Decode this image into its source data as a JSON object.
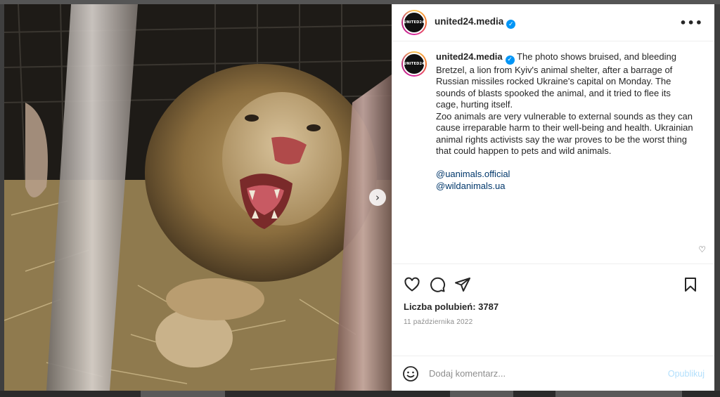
{
  "post": {
    "username": "united24.media",
    "verified_mark": "✓",
    "avatar_text": "UNITED24",
    "more_label": "•••",
    "caption": {
      "username": "united24.media",
      "paragraph_1": "The photo shows bruised, and bleeding Bretzel, a lion from Kyiv's animal shelter, after a barrage of Russian missiles rocked Ukraine's capital on Monday. The sounds of blasts spooked the animal, and it tried to flee its cage, hurting itself.",
      "paragraph_2": "Zoo animals are very vulnerable to external sounds as they can cause irreparable harm to their well-being and health. Ukrainian animal rights activists say the war proves to be the worst thing that could happen to pets and wild animals.",
      "tags": [
        "@uanimals.official",
        "@wildanimals.ua"
      ]
    },
    "likes_text": "Liczba polubień: 3787",
    "date_text": "11 października 2022",
    "comment_placeholder": "Dodaj komentarz...",
    "publish_label": "Opublikuj",
    "carousel_next": "›",
    "small_heart": "♡"
  },
  "colors": {
    "link": "#00376b",
    "verified": "#0095f6",
    "publish_disabled": "#b2dffc",
    "muted": "#8e8e8e"
  },
  "icons": {
    "like": "heart-icon",
    "comment": "comment-icon",
    "share": "paper-plane-icon",
    "save": "bookmark-icon",
    "emoji": "smiley-icon",
    "more": "ellipsis-icon"
  }
}
